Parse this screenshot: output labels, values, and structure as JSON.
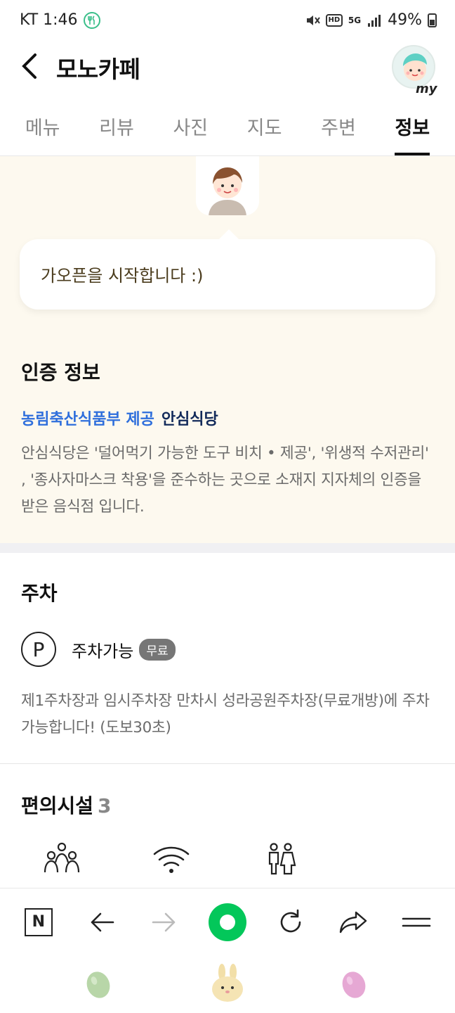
{
  "status_bar": {
    "carrier_time": "KT 1:46",
    "battery_pct": "49%",
    "network": "5G",
    "hd_label": "HD"
  },
  "header": {
    "title": "모노카페",
    "my_badge": "my"
  },
  "tabs": [
    {
      "label": "메뉴",
      "active": false
    },
    {
      "label": "리뷰",
      "active": false
    },
    {
      "label": "사진",
      "active": false
    },
    {
      "label": "지도",
      "active": false
    },
    {
      "label": "주변",
      "active": false
    },
    {
      "label": "정보",
      "active": true
    }
  ],
  "notice": {
    "message": "가오픈을 시작합니다 :)",
    "cert_title": "인증 정보",
    "cert_provider": "농림축산식품부 제공",
    "cert_name": "안심식당",
    "cert_desc": "안심식당은 '덜어먹기 가능한 도구 비치 • 제공', '위생적 수저관리' , '종사자마스크 착용'을 준수하는 곳으로 소재지 지자체의 인증을 받은 음식점 입니다."
  },
  "parking": {
    "title": "주차",
    "icon_letter": "P",
    "label": "주차가능",
    "badge": "무료",
    "desc": "제1주차장과 임시주차장 만차시 성라공원주차장(무료개방)에 주차 가능합니다! (도보30초)"
  },
  "facilities": {
    "title": "편의시설",
    "count": "3",
    "icons": [
      "group-icon",
      "wifi-icon",
      "restroom-icon"
    ]
  },
  "browser_bar": {
    "n_label": "N"
  },
  "colors": {
    "accent_green": "#03c75a",
    "provider_blue": "#2f6fdc",
    "notice_bg": "#fdf9ef"
  }
}
